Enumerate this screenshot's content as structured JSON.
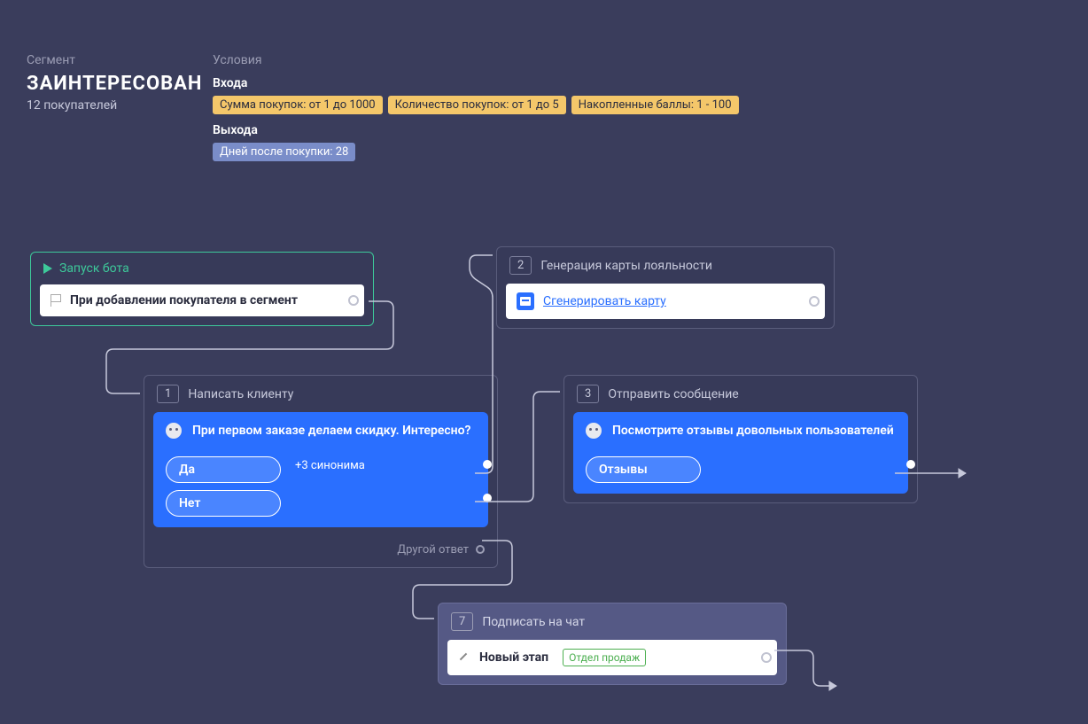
{
  "header": {
    "segment_label": "Сегмент",
    "segment_title": "ЗАИНТЕРЕСОВАН",
    "segment_count": "12 покупателей"
  },
  "conditions": {
    "label": "Условия",
    "entry_label": "Входа",
    "entry_tags": [
      "Сумма покупок: от 1 до 1000",
      "Количество покупок: от 1 до 5",
      "Накопленные баллы: 1 - 100"
    ],
    "exit_label": "Выхода",
    "exit_tags": [
      "Дней после покупки: 28"
    ]
  },
  "nodes": {
    "start": {
      "title": "Запуск бота",
      "trigger": "При добавлении покупателя в сегмент"
    },
    "n1": {
      "num": "1",
      "title": "Написать клиенту",
      "message": "При первом заказе делаем скидку. Интересно?",
      "opt_yes": "Да",
      "synonym": "+3 синонима",
      "opt_no": "Нет",
      "other": "Другой ответ"
    },
    "n2": {
      "num": "2",
      "title": "Генерация карты лояльности",
      "link": "Сгенерировать карту"
    },
    "n3": {
      "num": "3",
      "title": "Отправить сообщение",
      "message": "Посмотрите отзывы довольных пользователей",
      "opt": "Отзывы"
    },
    "n7": {
      "num": "7",
      "title": "Подписать на чат",
      "stage": "Новый этап",
      "dept": "Отдел продаж"
    }
  }
}
